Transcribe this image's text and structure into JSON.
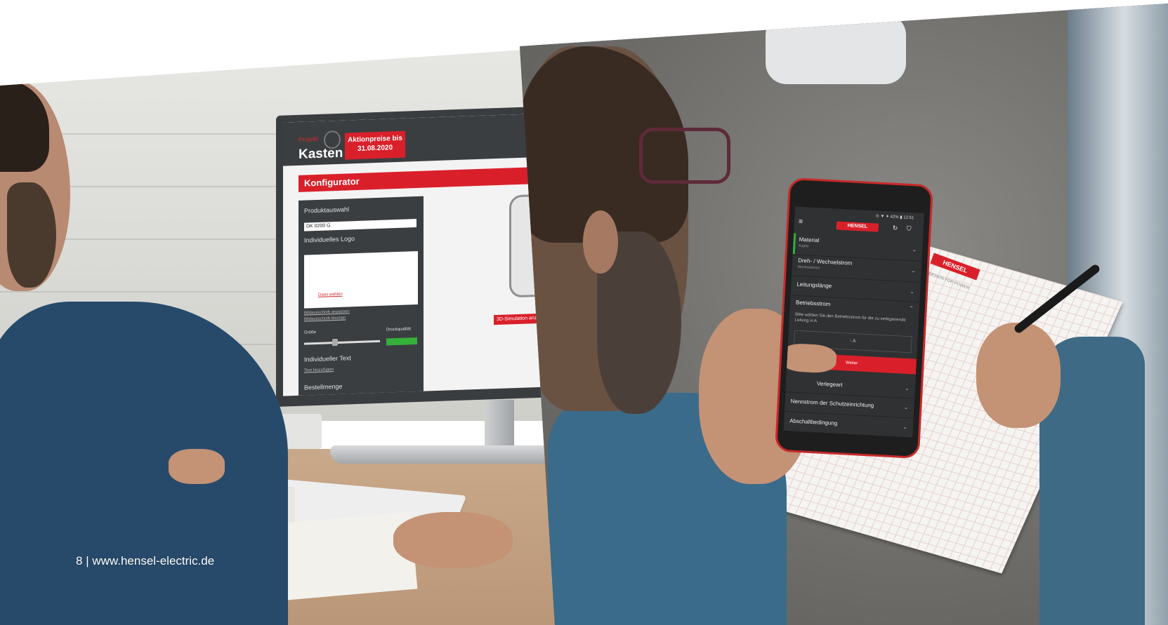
{
  "footer": {
    "page_number": "8",
    "separator": "|",
    "url": "www.hensel-electric.de"
  },
  "desktop_screen": {
    "logo_small": "Projekt",
    "logo": "Kasten",
    "promo": "Aktionpreise bis 31.08.2020",
    "title": "Konfigurator",
    "panel": {
      "product_label": "Produktauswahl",
      "product_value": "DK 0200 G",
      "logo_label": "Individuelles Logo",
      "logo_link": "Datei wählen",
      "link1": "Bildausschnitt anpassen",
      "link2": "Bildausschnitt löschen",
      "size_label": "Größe",
      "quality_label": "Druckqualität",
      "text_label": "Individueller Text",
      "text_link": "Text hinzufügen",
      "quantity_label": "Bestellmenge"
    },
    "simulation_button": "3D-Simulation anz"
  },
  "phone_screen": {
    "status": "⊙ ▼ ✦ 42% ▮ 12:51",
    "logo": "HENSEL",
    "rows": [
      {
        "title": "Material",
        "sub": "Kupfer"
      },
      {
        "title": "Dreh- / Wechselstrom",
        "sub": "Wechselstrom"
      },
      {
        "title": "Leitungslänge",
        "sub": ""
      },
      {
        "title": "Betriebsstrom",
        "sub": ""
      }
    ],
    "description": "Bitte wählen Sie den Betriebsstrom für die zu verlegenende Leitung in A",
    "input_placeholder": "- A",
    "button": "Weiter",
    "rows_below": [
      {
        "title": "Verlegeart"
      },
      {
        "title": "Nennstrom der Schutzeinrichtung"
      },
      {
        "title": "Abschaltbedingung"
      }
    ]
  },
  "notepad": {
    "logo": "HENSEL",
    "slogan": "DESIGN FOR POWER"
  },
  "colors": {
    "brand_red": "#d9202a",
    "dark_ui": "#3b3e41",
    "quality_green": "#35b03a"
  }
}
